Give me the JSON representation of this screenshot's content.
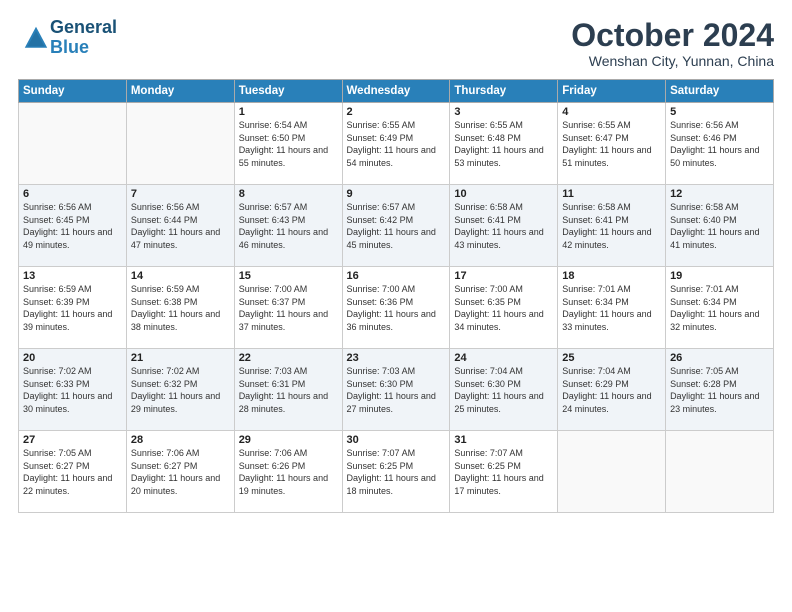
{
  "header": {
    "logo_line1": "General",
    "logo_line2": "Blue",
    "month_title": "October 2024",
    "subtitle": "Wenshan City, Yunnan, China"
  },
  "days_of_week": [
    "Sunday",
    "Monday",
    "Tuesday",
    "Wednesday",
    "Thursday",
    "Friday",
    "Saturday"
  ],
  "weeks": [
    [
      {
        "day": "",
        "sunrise": "",
        "sunset": "",
        "daylight": ""
      },
      {
        "day": "",
        "sunrise": "",
        "sunset": "",
        "daylight": ""
      },
      {
        "day": "1",
        "sunrise": "Sunrise: 6:54 AM",
        "sunset": "Sunset: 6:50 PM",
        "daylight": "Daylight: 11 hours and 55 minutes."
      },
      {
        "day": "2",
        "sunrise": "Sunrise: 6:55 AM",
        "sunset": "Sunset: 6:49 PM",
        "daylight": "Daylight: 11 hours and 54 minutes."
      },
      {
        "day": "3",
        "sunrise": "Sunrise: 6:55 AM",
        "sunset": "Sunset: 6:48 PM",
        "daylight": "Daylight: 11 hours and 53 minutes."
      },
      {
        "day": "4",
        "sunrise": "Sunrise: 6:55 AM",
        "sunset": "Sunset: 6:47 PM",
        "daylight": "Daylight: 11 hours and 51 minutes."
      },
      {
        "day": "5",
        "sunrise": "Sunrise: 6:56 AM",
        "sunset": "Sunset: 6:46 PM",
        "daylight": "Daylight: 11 hours and 50 minutes."
      }
    ],
    [
      {
        "day": "6",
        "sunrise": "Sunrise: 6:56 AM",
        "sunset": "Sunset: 6:45 PM",
        "daylight": "Daylight: 11 hours and 49 minutes."
      },
      {
        "day": "7",
        "sunrise": "Sunrise: 6:56 AM",
        "sunset": "Sunset: 6:44 PM",
        "daylight": "Daylight: 11 hours and 47 minutes."
      },
      {
        "day": "8",
        "sunrise": "Sunrise: 6:57 AM",
        "sunset": "Sunset: 6:43 PM",
        "daylight": "Daylight: 11 hours and 46 minutes."
      },
      {
        "day": "9",
        "sunrise": "Sunrise: 6:57 AM",
        "sunset": "Sunset: 6:42 PM",
        "daylight": "Daylight: 11 hours and 45 minutes."
      },
      {
        "day": "10",
        "sunrise": "Sunrise: 6:58 AM",
        "sunset": "Sunset: 6:41 PM",
        "daylight": "Daylight: 11 hours and 43 minutes."
      },
      {
        "day": "11",
        "sunrise": "Sunrise: 6:58 AM",
        "sunset": "Sunset: 6:41 PM",
        "daylight": "Daylight: 11 hours and 42 minutes."
      },
      {
        "day": "12",
        "sunrise": "Sunrise: 6:58 AM",
        "sunset": "Sunset: 6:40 PM",
        "daylight": "Daylight: 11 hours and 41 minutes."
      }
    ],
    [
      {
        "day": "13",
        "sunrise": "Sunrise: 6:59 AM",
        "sunset": "Sunset: 6:39 PM",
        "daylight": "Daylight: 11 hours and 39 minutes."
      },
      {
        "day": "14",
        "sunrise": "Sunrise: 6:59 AM",
        "sunset": "Sunset: 6:38 PM",
        "daylight": "Daylight: 11 hours and 38 minutes."
      },
      {
        "day": "15",
        "sunrise": "Sunrise: 7:00 AM",
        "sunset": "Sunset: 6:37 PM",
        "daylight": "Daylight: 11 hours and 37 minutes."
      },
      {
        "day": "16",
        "sunrise": "Sunrise: 7:00 AM",
        "sunset": "Sunset: 6:36 PM",
        "daylight": "Daylight: 11 hours and 36 minutes."
      },
      {
        "day": "17",
        "sunrise": "Sunrise: 7:00 AM",
        "sunset": "Sunset: 6:35 PM",
        "daylight": "Daylight: 11 hours and 34 minutes."
      },
      {
        "day": "18",
        "sunrise": "Sunrise: 7:01 AM",
        "sunset": "Sunset: 6:34 PM",
        "daylight": "Daylight: 11 hours and 33 minutes."
      },
      {
        "day": "19",
        "sunrise": "Sunrise: 7:01 AM",
        "sunset": "Sunset: 6:34 PM",
        "daylight": "Daylight: 11 hours and 32 minutes."
      }
    ],
    [
      {
        "day": "20",
        "sunrise": "Sunrise: 7:02 AM",
        "sunset": "Sunset: 6:33 PM",
        "daylight": "Daylight: 11 hours and 30 minutes."
      },
      {
        "day": "21",
        "sunrise": "Sunrise: 7:02 AM",
        "sunset": "Sunset: 6:32 PM",
        "daylight": "Daylight: 11 hours and 29 minutes."
      },
      {
        "day": "22",
        "sunrise": "Sunrise: 7:03 AM",
        "sunset": "Sunset: 6:31 PM",
        "daylight": "Daylight: 11 hours and 28 minutes."
      },
      {
        "day": "23",
        "sunrise": "Sunrise: 7:03 AM",
        "sunset": "Sunset: 6:30 PM",
        "daylight": "Daylight: 11 hours and 27 minutes."
      },
      {
        "day": "24",
        "sunrise": "Sunrise: 7:04 AM",
        "sunset": "Sunset: 6:30 PM",
        "daylight": "Daylight: 11 hours and 25 minutes."
      },
      {
        "day": "25",
        "sunrise": "Sunrise: 7:04 AM",
        "sunset": "Sunset: 6:29 PM",
        "daylight": "Daylight: 11 hours and 24 minutes."
      },
      {
        "day": "26",
        "sunrise": "Sunrise: 7:05 AM",
        "sunset": "Sunset: 6:28 PM",
        "daylight": "Daylight: 11 hours and 23 minutes."
      }
    ],
    [
      {
        "day": "27",
        "sunrise": "Sunrise: 7:05 AM",
        "sunset": "Sunset: 6:27 PM",
        "daylight": "Daylight: 11 hours and 22 minutes."
      },
      {
        "day": "28",
        "sunrise": "Sunrise: 7:06 AM",
        "sunset": "Sunset: 6:27 PM",
        "daylight": "Daylight: 11 hours and 20 minutes."
      },
      {
        "day": "29",
        "sunrise": "Sunrise: 7:06 AM",
        "sunset": "Sunset: 6:26 PM",
        "daylight": "Daylight: 11 hours and 19 minutes."
      },
      {
        "day": "30",
        "sunrise": "Sunrise: 7:07 AM",
        "sunset": "Sunset: 6:25 PM",
        "daylight": "Daylight: 11 hours and 18 minutes."
      },
      {
        "day": "31",
        "sunrise": "Sunrise: 7:07 AM",
        "sunset": "Sunset: 6:25 PM",
        "daylight": "Daylight: 11 hours and 17 minutes."
      },
      {
        "day": "",
        "sunrise": "",
        "sunset": "",
        "daylight": ""
      },
      {
        "day": "",
        "sunrise": "",
        "sunset": "",
        "daylight": ""
      }
    ]
  ]
}
